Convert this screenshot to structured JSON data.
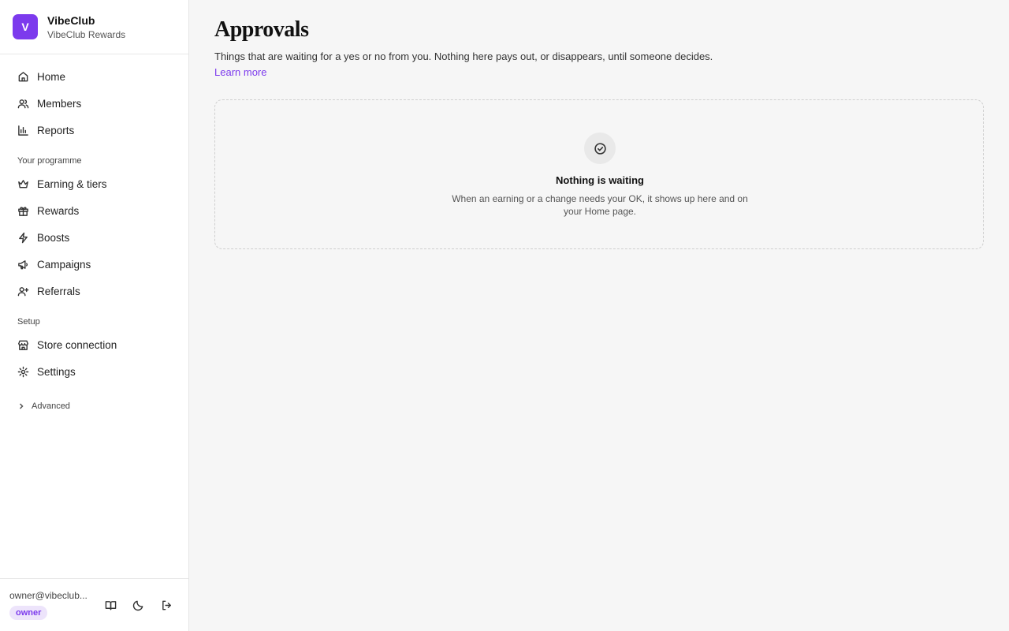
{
  "brand": {
    "initial": "V",
    "name": "VibeClub",
    "subtitle": "VibeClub Rewards",
    "color": "#7c3aed"
  },
  "nav": {
    "main": [
      {
        "label": "Home",
        "icon": "home-icon"
      },
      {
        "label": "Members",
        "icon": "users-icon"
      },
      {
        "label": "Reports",
        "icon": "bar-chart-icon"
      }
    ],
    "programme_heading": "Your programme",
    "programme": [
      {
        "label": "Earning & tiers",
        "icon": "crown-icon"
      },
      {
        "label": "Rewards",
        "icon": "gift-icon"
      },
      {
        "label": "Boosts",
        "icon": "bolt-icon"
      },
      {
        "label": "Campaigns",
        "icon": "megaphone-icon"
      },
      {
        "label": "Referrals",
        "icon": "user-plus-icon"
      }
    ],
    "setup_heading": "Setup",
    "setup": [
      {
        "label": "Store connection",
        "icon": "store-icon"
      },
      {
        "label": "Settings",
        "icon": "gear-icon"
      }
    ],
    "advanced_label": "Advanced"
  },
  "footer": {
    "email": "owner@vibeclub...",
    "role": "owner",
    "icons": [
      "book-icon",
      "moon-icon",
      "logout-icon"
    ]
  },
  "page": {
    "title": "Approvals",
    "description": "Things that are waiting for a yes or no from you. Nothing here pays out, or disappears, until someone decides.",
    "learn_more": "Learn more"
  },
  "empty_state": {
    "icon": "check-circle-icon",
    "title": "Nothing is waiting",
    "text": "When an earning or a change needs your OK, it shows up here and on your Home page."
  }
}
